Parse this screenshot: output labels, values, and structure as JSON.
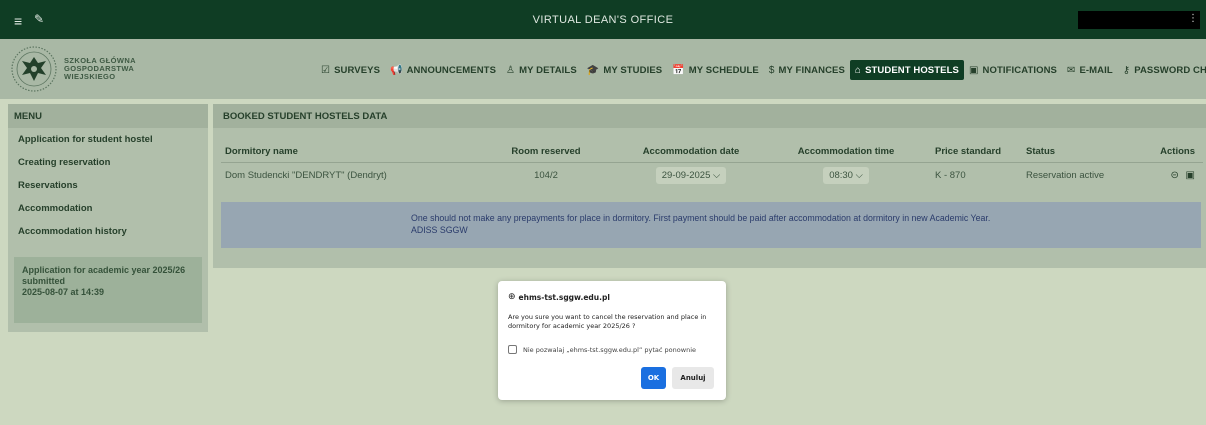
{
  "topbar": {
    "menu_icon": "≡",
    "pin_icon": "✎",
    "title": "VIRTUAL DEAN'S OFFICE",
    "user_kebab": "⋮"
  },
  "logo": {
    "line1": "SZKOŁA GŁÓWNA",
    "line2": "GOSPODARSTWA",
    "line3": "WIEJSKIEGO"
  },
  "nav": {
    "items": [
      {
        "icon": "☑",
        "label": "SURVEYS"
      },
      {
        "icon": "📢",
        "label": "ANNOUNCEMENTS"
      },
      {
        "icon": "♙",
        "label": "MY DETAILS"
      },
      {
        "icon": "🎓",
        "label": "MY STUDIES"
      },
      {
        "icon": "📅",
        "label": "MY SCHEDULE"
      },
      {
        "icon": "$",
        "label": "MY FINANCES"
      },
      {
        "icon": "⌂",
        "label": "STUDENT HOSTELS"
      },
      {
        "icon": "▣",
        "label": "NOTIFICATIONS"
      },
      {
        "icon": "✉",
        "label": "E-MAIL"
      },
      {
        "icon": "⚷",
        "label": "PASSWORD CHANGE"
      }
    ]
  },
  "sidebar": {
    "title": "MENU",
    "items": [
      "Application for student hostel",
      "Creating reservation",
      "Reservations",
      "Accommodation",
      "Accommodation history"
    ],
    "status_line1": "Application for academic year 2025/26",
    "status_line2": "submitted",
    "status_line3": "2025-08-07 at 14:39"
  },
  "main": {
    "title": "BOOKED STUDENT HOSTELS DATA",
    "columns": [
      "Dormitory name",
      "Room reserved",
      "Accommodation date",
      "Accommodation time",
      "Price standard",
      "Status",
      "Actions"
    ],
    "row": {
      "dormitory": "Dom Studencki \"DENDRYT\" (Dendryt)",
      "room": "104/2",
      "date": "29-09-2025",
      "time": "08:30",
      "price": "K - 870",
      "status": "Reservation active"
    },
    "info_line1": "One should not make any prepayments for place in dormitory. First payment should be paid after accommodation at dormitory in new Academic Year.",
    "info_line2": "ADISS SGGW"
  },
  "dialog": {
    "origin": "ehms-tst.sggw.edu.pl",
    "message": "Are you sure you want to cancel the reservation and place in dormitory for academic year 2025/26 ?",
    "checkbox_label": "Nie pozwalaj „ehms-tst.sggw.edu.pl” pytać ponownie",
    "ok_label": "OK",
    "cancel_label": "Anuluj"
  },
  "colors": {
    "topbar": "#0f3d24",
    "header": "#a9b8a5",
    "panel": "#b1bfab",
    "info_box": "#97a6b2",
    "ok_button": "#1a6fe0"
  }
}
